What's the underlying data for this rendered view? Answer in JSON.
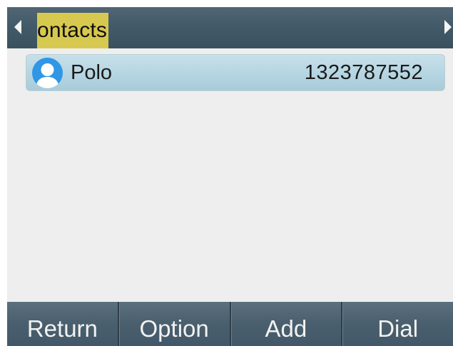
{
  "header": {
    "title": "ontacts",
    "left_arrow_icon": "arrow-left-icon",
    "right_arrow_icon": "arrow-right-icon"
  },
  "contacts": [
    {
      "name": "Polo",
      "number": "1323787552",
      "avatar_icon": "person-avatar-icon",
      "selected": true
    }
  ],
  "softkeys": [
    {
      "label": "Return"
    },
    {
      "label": "Option"
    },
    {
      "label": "Add"
    },
    {
      "label": "Dial"
    }
  ],
  "colors": {
    "title_bar": "#425a69",
    "title_highlight": "#d7c94f",
    "selected_row": "#b4d5e1",
    "avatar": "#2f97e6",
    "list_background": "#eeeeee",
    "softkey_bar": "#4a5f6d"
  }
}
